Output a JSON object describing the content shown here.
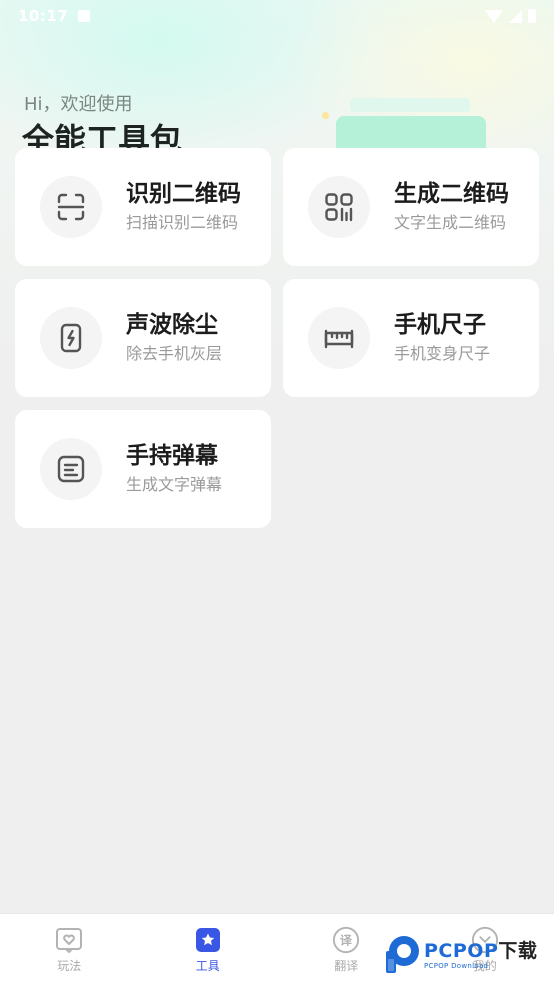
{
  "status_bar": {
    "time": "10:17"
  },
  "header": {
    "greeting": "Hi，欢迎使用",
    "title": "全能工具包"
  },
  "tools": [
    {
      "title": "识别二维码",
      "subtitle": "扫描识别二维码",
      "icon": "scan-icon"
    },
    {
      "title": "生成二维码",
      "subtitle": "文字生成二维码",
      "icon": "qrcode-icon"
    },
    {
      "title": "声波除尘",
      "subtitle": "除去手机灰层",
      "icon": "phone-bolt-icon"
    },
    {
      "title": "手机尺子",
      "subtitle": "手机变身尺子",
      "icon": "ruler-icon"
    },
    {
      "title": "手持弹幕",
      "subtitle": "生成文字弹幕",
      "icon": "barrage-icon"
    }
  ],
  "tabbar": {
    "active_color": "#3a56e4",
    "items": [
      {
        "label": "玩法",
        "icon": "heart-chat-icon"
      },
      {
        "label": "工具",
        "icon": "star-bookmark-icon",
        "active": true
      },
      {
        "label": "翻译",
        "icon": "translate-icon"
      },
      {
        "label": "我的",
        "icon": "profile-icon"
      }
    ]
  },
  "watermark": {
    "brand": "PCPOP",
    "brand_cn": "下载",
    "sub": "PCPOP Download"
  }
}
